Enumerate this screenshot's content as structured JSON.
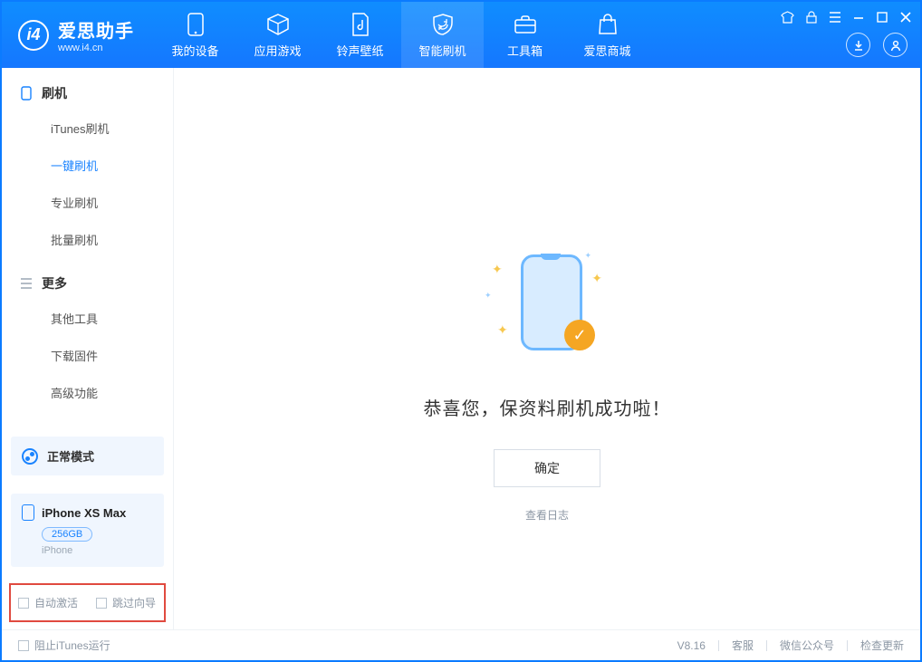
{
  "brand": {
    "cn": "爱思助手",
    "en": "www.i4.cn"
  },
  "tabs": [
    {
      "id": "device",
      "label": "我的设备"
    },
    {
      "id": "apps",
      "label": "应用游戏"
    },
    {
      "id": "ring",
      "label": "铃声壁纸"
    },
    {
      "id": "flash",
      "label": "智能刷机"
    },
    {
      "id": "tools",
      "label": "工具箱"
    },
    {
      "id": "store",
      "label": "爱思商城"
    }
  ],
  "sidebar": {
    "section_flash": {
      "title": "刷机",
      "items": [
        {
          "id": "itunes",
          "label": "iTunes刷机"
        },
        {
          "id": "onekey",
          "label": "一键刷机"
        },
        {
          "id": "pro",
          "label": "专业刷机"
        },
        {
          "id": "batch",
          "label": "批量刷机"
        }
      ]
    },
    "section_more": {
      "title": "更多",
      "items": [
        {
          "id": "other",
          "label": "其他工具"
        },
        {
          "id": "firmware",
          "label": "下载固件"
        },
        {
          "id": "advanced",
          "label": "高级功能"
        }
      ]
    },
    "mode": {
      "label": "正常模式"
    },
    "device": {
      "name": "iPhone XS Max",
      "capacity": "256GB",
      "subtitle": "iPhone"
    },
    "bottom_options": {
      "auto_activate": "自动激活",
      "skip_guide": "跳过向导"
    }
  },
  "main": {
    "title": "恭喜您，保资料刷机成功啦！",
    "ok_label": "确定",
    "log_label": "查看日志"
  },
  "footer": {
    "block_itunes": "阻止iTunes运行",
    "version": "V8.16",
    "support": "客服",
    "wechat": "微信公众号",
    "update": "检查更新"
  }
}
